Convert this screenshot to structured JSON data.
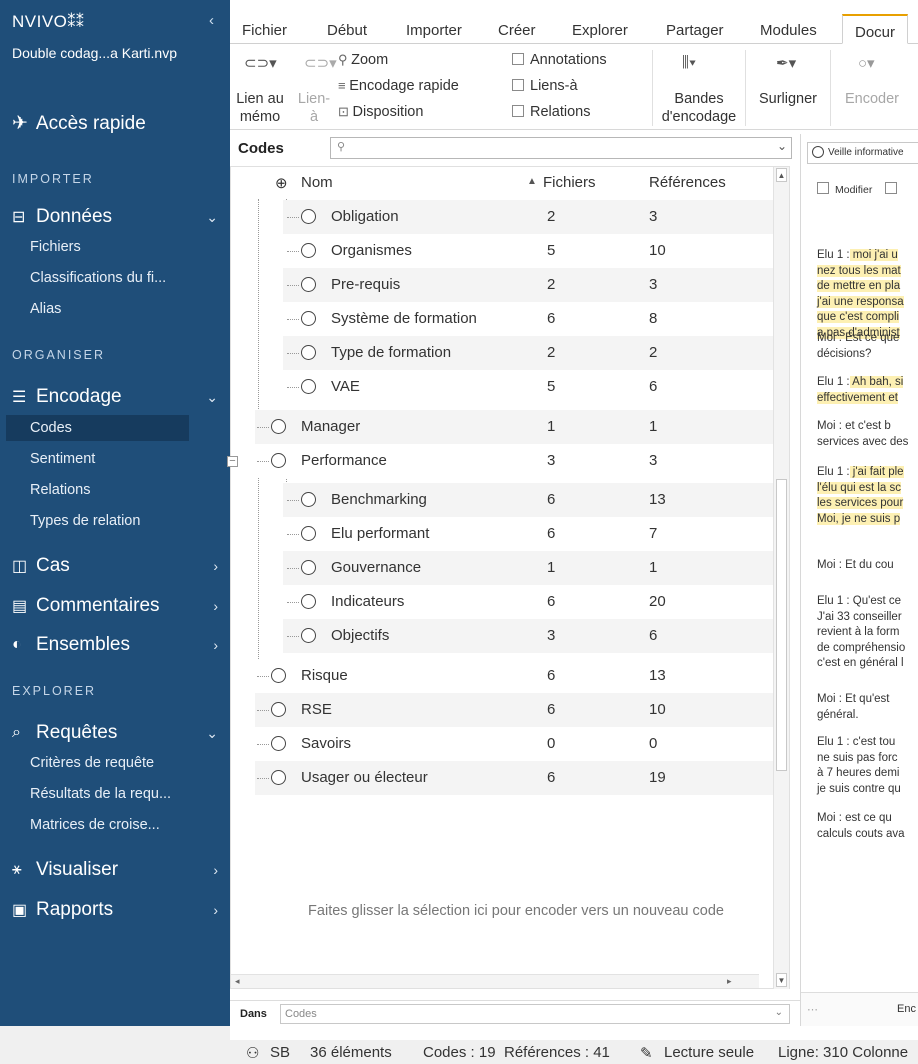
{
  "sidebar": {
    "logo": "NVIVO",
    "logo_mark": "⁑⁑",
    "collapse": "‹",
    "project": "Double codag...a Karti.nvp",
    "quick_access": "Accès rapide",
    "sections": {
      "import": "IMPORTER",
      "organise": "ORGANISER",
      "explore": "EXPLORER"
    },
    "groups": {
      "donnees": "Données",
      "encodage": "Encodage",
      "cas": "Cas",
      "commentaires": "Commentaires",
      "ensembles": "Ensembles",
      "requetes": "Requêtes",
      "visualiser": "Visualiser",
      "rapports": "Rapports"
    },
    "donnees_items": [
      "Fichiers",
      "Classifications du fi...",
      "Alias"
    ],
    "encodage_items": [
      "Codes",
      "Sentiment",
      "Relations",
      "Types de relation"
    ],
    "requetes_items": [
      "Critères de requête",
      "Résultats de la requ...",
      "Matrices de croise..."
    ]
  },
  "ribbon": {
    "tabs": [
      "Fichier",
      "Début",
      "Importer",
      "Créer",
      "Explorer",
      "Partager",
      "Modules",
      "Docur"
    ],
    "active_tab": "Docur",
    "lien_memo": [
      "Lien au",
      "mémo"
    ],
    "lien_a": [
      "Lien-",
      "à"
    ],
    "zoom": "Zoom",
    "encodage_rapide": "Encodage rapide",
    "disposition": "Disposition",
    "annotations": "Annotations",
    "liens_a": "Liens-à",
    "relations": "Relations",
    "bandes": [
      "Bandes",
      "d'encodage"
    ],
    "surligner": "Surligner",
    "encoder": "Encoder"
  },
  "codes": {
    "title": "Codes",
    "search_placeholder": "",
    "columns": {
      "name": "Nom",
      "files": "Fichiers",
      "refs": "Références",
      "sort_indicator": "▲"
    },
    "rows": [
      {
        "name": "Obligation",
        "files": "2",
        "refs": "3"
      },
      {
        "name": "Organismes",
        "files": "5",
        "refs": "10"
      },
      {
        "name": "Pre-requis",
        "files": "2",
        "refs": "3"
      },
      {
        "name": "Système de formation",
        "files": "6",
        "refs": "8"
      },
      {
        "name": "Type de formation",
        "files": "2",
        "refs": "2"
      },
      {
        "name": "VAE",
        "files": "5",
        "refs": "6"
      },
      {
        "name": "Manager",
        "files": "1",
        "refs": "1"
      },
      {
        "name": "Performance",
        "files": "3",
        "refs": "3"
      },
      {
        "name": "Benchmarking",
        "files": "6",
        "refs": "13"
      },
      {
        "name": "Elu performant",
        "files": "6",
        "refs": "7"
      },
      {
        "name": "Gouvernance",
        "files": "1",
        "refs": "1"
      },
      {
        "name": "Indicateurs",
        "files": "6",
        "refs": "20"
      },
      {
        "name": "Objectifs",
        "files": "3",
        "refs": "6"
      },
      {
        "name": "Risque",
        "files": "6",
        "refs": "13"
      },
      {
        "name": "RSE",
        "files": "6",
        "refs": "10"
      },
      {
        "name": "Savoirs",
        "files": "0",
        "refs": "0"
      },
      {
        "name": "Usager ou électeur",
        "files": "6",
        "refs": "19"
      }
    ],
    "drop_hint": "Faites glisser la sélection ici pour encoder vers un nouveau code",
    "in_label": "Dans",
    "in_value": "Codes"
  },
  "document": {
    "tab": "Veille informative",
    "modifier": "Modifier",
    "paragraphs": [
      {
        "lines": [
          "Elu 1 :  moi j'ai u",
          "nez tous les mat",
          "de mettre en pla",
          "j'ai une responsa",
          "que c'est compli",
          "a pas d'administ"
        ]
      },
      {
        "lines": [
          "Moi : Est ce que",
          "décisions?"
        ]
      },
      {
        "lines": [
          "Elu 1 : Ah bah, si",
          "effectivement et"
        ]
      },
      {
        "lines": [
          "Moi :   et c'est b",
          "services avec des"
        ]
      },
      {
        "lines": [
          "Elu 1 : j'ai fait ple",
          "l'élu qui est la  sc",
          "les services pour",
          "Moi, je ne suis p"
        ]
      },
      {
        "lines": [
          "Moi :   Et du cou"
        ]
      },
      {
        "lines": [
          "Elu 1 : Qu'est ce",
          "J'ai 33 conseiller",
          "revient à la form",
          "de compréhensio",
          "c'est en général l"
        ]
      },
      {
        "lines": [
          "Moi :   Et qu'est",
          "général."
        ]
      },
      {
        "lines": [
          "Elu 1 :  c'est tou",
          "ne suis pas  forc",
          "à 7 heures demi",
          "je suis contre qu"
        ]
      },
      {
        "lines": [
          "Moi :   est ce qu",
          "calculs couts ava"
        ]
      }
    ],
    "bottom": "Enc"
  },
  "status": {
    "user": "SB",
    "items": "36 éléments",
    "codes": "Codes : 19",
    "refs": "Références : 41",
    "readonly": "Lecture seule",
    "position": "Ligne: 310 Colonne"
  },
  "colors": {
    "sidebar": "#1f4e79",
    "active_tab_accent": "#e8a000",
    "highlight": "#fdf0b3"
  }
}
